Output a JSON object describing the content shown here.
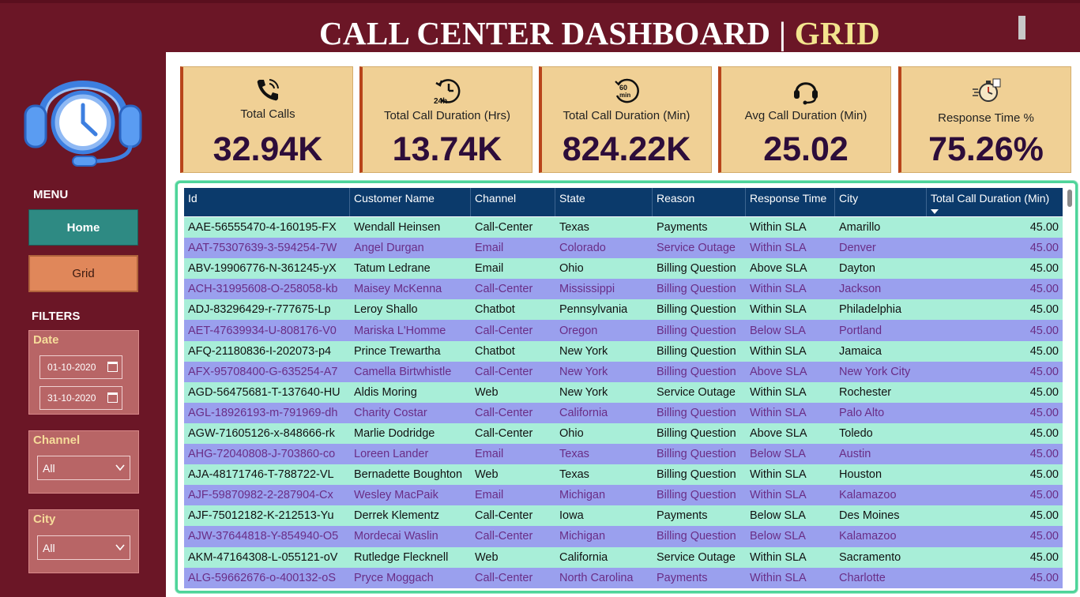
{
  "header": {
    "title_main": "CALL CENTER DASHBOARD | ",
    "title_accent": "GRID"
  },
  "sidebar": {
    "menu_label": "MENU",
    "home_label": "Home",
    "grid_label": "Grid",
    "filters_label": "FILTERS",
    "date": {
      "title": "Date",
      "start": "01-10-2020",
      "end": "31-10-2020"
    },
    "channel": {
      "title": "Channel",
      "value": "All"
    },
    "city": {
      "title": "City",
      "value": "All"
    }
  },
  "kpis": [
    {
      "label": "Total Calls",
      "value": "32.94K",
      "icon": "phone-icon"
    },
    {
      "label": "Total Call Duration (Hrs)",
      "value": "13.74K",
      "icon": "24h-clock-icon"
    },
    {
      "label": "Total Call Duration (Min)",
      "value": "824.22K",
      "icon": "60min-timer-icon"
    },
    {
      "label": "Avg Call Duration (Min)",
      "value": "25.02",
      "icon": "headset-icon"
    },
    {
      "label": "Response Time %",
      "value": "75.26%",
      "icon": "stopwatch-icon"
    }
  ],
  "table": {
    "columns": [
      "Id",
      "Customer Name",
      "Channel",
      "State",
      "Reason",
      "Response Time",
      "City",
      "Total Call Duration (Min)"
    ],
    "rows": [
      [
        "AAE-56555470-4-160195-FX",
        "Wendall Heinsen",
        "Call-Center",
        "Texas",
        "Payments",
        "Within SLA",
        "Amarillo",
        "45.00"
      ],
      [
        "AAT-75307639-3-594254-7W",
        "Angel Durgan",
        "Email",
        "Colorado",
        "Service Outage",
        "Within SLA",
        "Denver",
        "45.00"
      ],
      [
        "ABV-19906776-N-361245-yX",
        "Tatum Ledrane",
        "Email",
        "Ohio",
        "Billing Question",
        "Above SLA",
        "Dayton",
        "45.00"
      ],
      [
        "ACH-31995608-O-258058-kb",
        "Maisey McKenna",
        "Call-Center",
        "Mississippi",
        "Billing Question",
        "Within SLA",
        "Jackson",
        "45.00"
      ],
      [
        "ADJ-83296429-r-777675-Lp",
        "Leroy Shallo",
        "Chatbot",
        "Pennsylvania",
        "Billing Question",
        "Within SLA",
        "Philadelphia",
        "45.00"
      ],
      [
        "AET-47639934-U-808176-V0",
        "Mariska L'Homme",
        "Call-Center",
        "Oregon",
        "Billing Question",
        "Below SLA",
        "Portland",
        "45.00"
      ],
      [
        "AFQ-21180836-I-202073-p4",
        "Prince Trewartha",
        "Chatbot",
        "New York",
        "Billing Question",
        "Within SLA",
        "Jamaica",
        "45.00"
      ],
      [
        "AFX-95708400-G-635254-A7",
        "Camella Birtwhistle",
        "Call-Center",
        "New York",
        "Billing Question",
        "Above SLA",
        "New York City",
        "45.00"
      ],
      [
        "AGD-56475681-T-137640-HU",
        "Aldis Moring",
        "Web",
        "New York",
        "Service Outage",
        "Within SLA",
        "Rochester",
        "45.00"
      ],
      [
        "AGL-18926193-m-791969-dh",
        "Charity Costar",
        "Call-Center",
        "California",
        "Billing Question",
        "Within SLA",
        "Palo Alto",
        "45.00"
      ],
      [
        "AGW-71605126-x-848666-rk",
        "Marlie Dodridge",
        "Call-Center",
        "Ohio",
        "Billing Question",
        "Above SLA",
        "Toledo",
        "45.00"
      ],
      [
        "AHG-72040808-J-703860-co",
        "Loreen Lander",
        "Email",
        "Texas",
        "Billing Question",
        "Below SLA",
        "Austin",
        "45.00"
      ],
      [
        "AJA-48171746-T-788722-VL",
        "Bernadette Boughton",
        "Web",
        "Texas",
        "Billing Question",
        "Within SLA",
        "Houston",
        "45.00"
      ],
      [
        "AJF-59870982-2-287904-Cx",
        "Wesley MacPaik",
        "Email",
        "Michigan",
        "Billing Question",
        "Within SLA",
        "Kalamazoo",
        "45.00"
      ],
      [
        "AJF-75012182-K-212513-Yu",
        "Derrek Klementz",
        "Call-Center",
        "Iowa",
        "Payments",
        "Below SLA",
        "Des Moines",
        "45.00"
      ],
      [
        "AJW-37644818-Y-854940-O5",
        "Mordecai Waslin",
        "Call-Center",
        "Michigan",
        "Billing Question",
        "Below SLA",
        "Kalamazoo",
        "45.00"
      ],
      [
        "AKM-47164308-L-055121-oV",
        "Rutledge Flecknell",
        "Web",
        "California",
        "Service Outage",
        "Within SLA",
        "Sacramento",
        "45.00"
      ],
      [
        "ALG-59662676-o-400132-oS",
        "Pryce Moggach",
        "Call-Center",
        "North Carolina",
        "Payments",
        "Within SLA",
        "Charlotte",
        "45.00"
      ]
    ]
  },
  "colors": {
    "background": "#6b1626",
    "kpi_card": "#f0d095",
    "table_header": "#0b3a6b",
    "row_even": "#a8eed8",
    "row_odd": "#9aa0ee",
    "accent": "#f3e48e"
  }
}
